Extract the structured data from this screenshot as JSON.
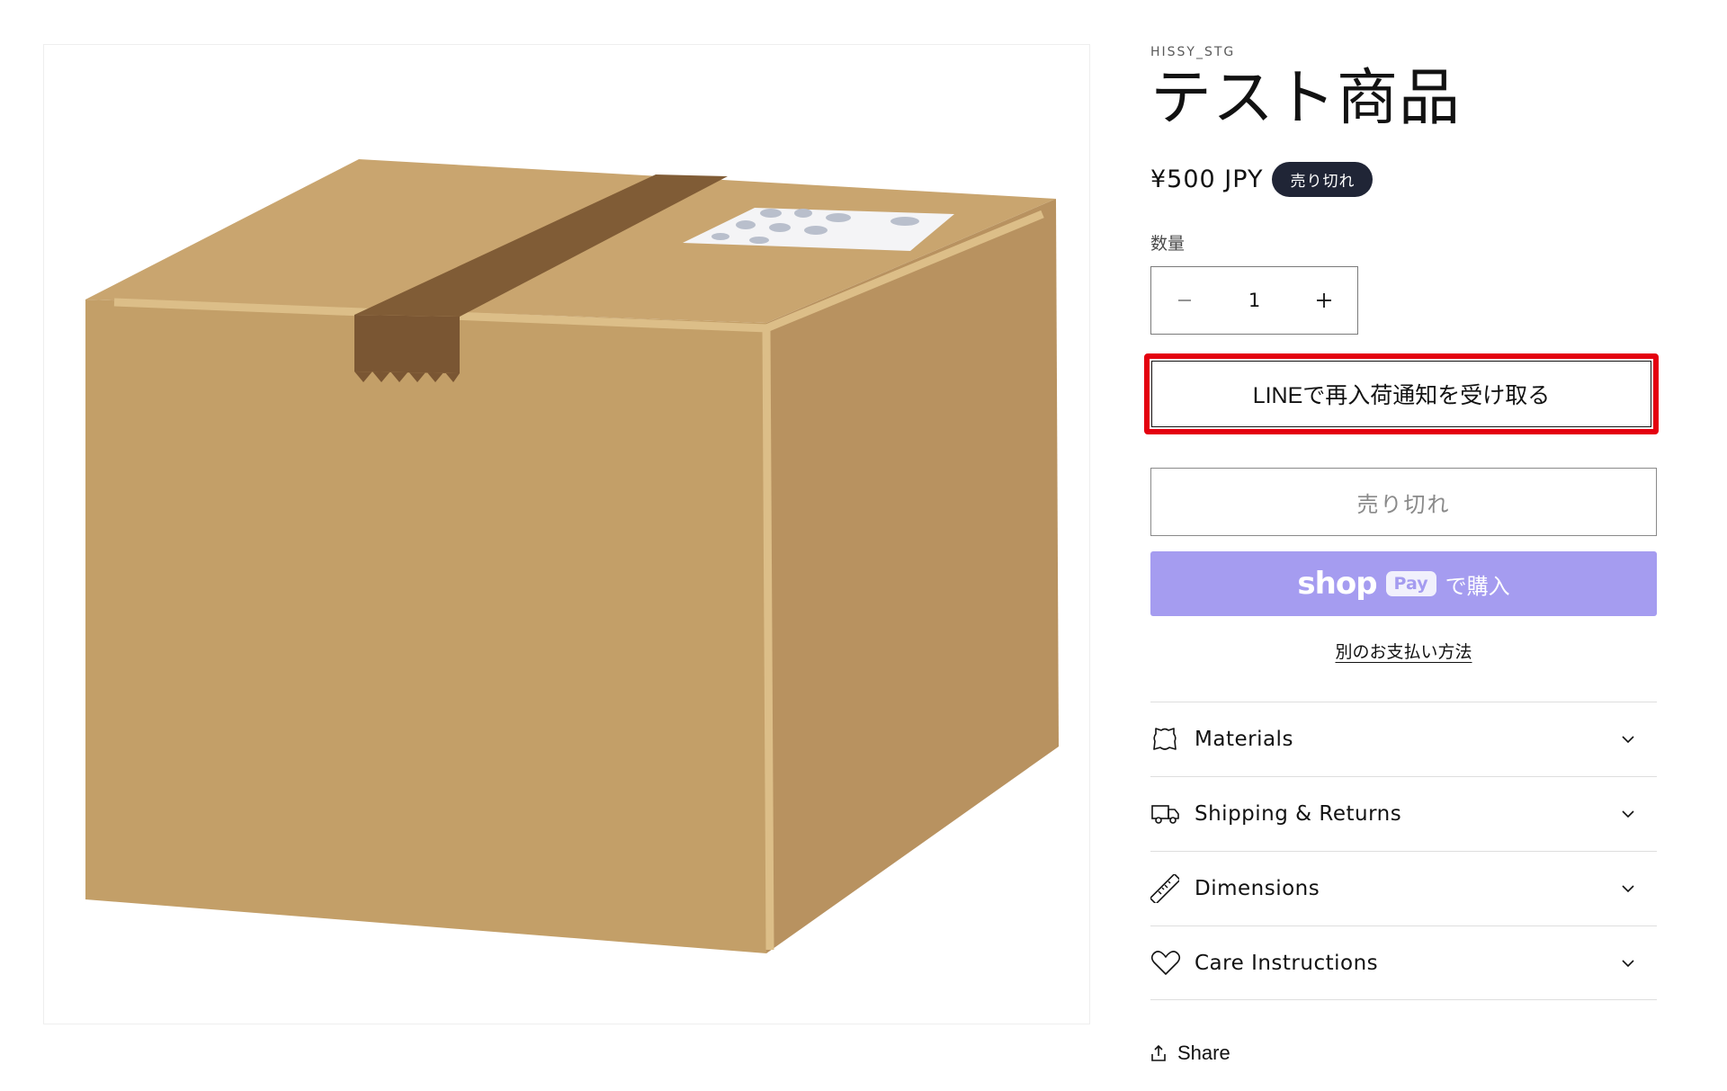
{
  "product": {
    "vendor": "HISSY_STG",
    "title": "テスト商品",
    "price": "¥500 JPY",
    "badge": "売り切れ",
    "image": "cardboard-box-illustration"
  },
  "quantity": {
    "label": "数量",
    "value": "1",
    "decrease_icon": "minus-icon",
    "increase_icon": "plus-icon"
  },
  "buttons": {
    "line_notify": "LINEで再入荷通知を受け取る",
    "sold_out": "売り切れ",
    "shop_pay": {
      "shop": "shop",
      "pay": "Pay",
      "suffix": "で購入"
    },
    "more_payment": "別のお支払い方法"
  },
  "accordions": [
    {
      "label": "Materials",
      "icon": "leather-icon"
    },
    {
      "label": "Shipping & Returns",
      "icon": "truck-icon"
    },
    {
      "label": "Dimensions",
      "icon": "ruler-icon"
    },
    {
      "label": "Care Instructions",
      "icon": "heart-icon"
    }
  ],
  "share": {
    "label": "Share",
    "icon": "share-icon"
  },
  "colors": {
    "highlight": "#e4000f",
    "shop_pay": "#a59cf0",
    "badge": "#202536",
    "box": "#c39f68"
  }
}
